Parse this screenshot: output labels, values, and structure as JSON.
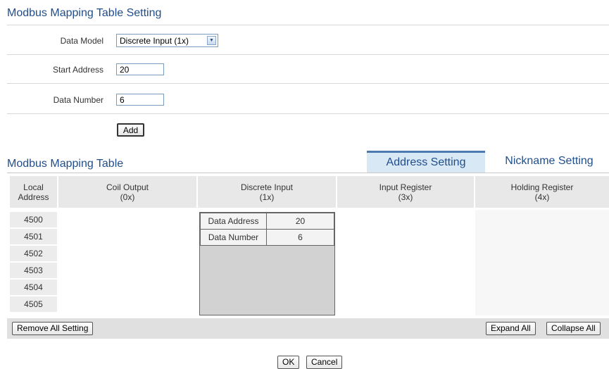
{
  "form": {
    "title": "Modbus Mapping Table Setting",
    "data_model_label": "Data Model",
    "data_model_value": "Discrete Input (1x)",
    "start_address_label": "Start Address",
    "start_address_value": "20",
    "data_number_label": "Data Number",
    "data_number_value": "6",
    "add_button": "Add"
  },
  "table": {
    "title": "Modbus Mapping Table",
    "tabs": {
      "address_setting": "Address Setting",
      "nickname_setting": "Nickname Setting"
    },
    "headers": {
      "local_address": [
        "Local",
        "Address"
      ],
      "coil_output": [
        "Coil Output",
        "(0x)"
      ],
      "discrete_input": [
        "Discrete Input",
        "(1x)"
      ],
      "input_register": [
        "Input Register",
        "(3x)"
      ],
      "holding_register": [
        "Holding Register",
        "(4x)"
      ]
    },
    "rows": [
      "4500",
      "4501",
      "4502",
      "4503",
      "4504",
      "4505"
    ],
    "discrete_entry": {
      "data_address_label": "Data Address",
      "data_address_value": "20",
      "data_number_label": "Data Number",
      "data_number_value": "6"
    },
    "remove_all_button": "Remove All Setting",
    "expand_all_button": "Expand All",
    "collapse_all_button": "Collapse All"
  },
  "footer": {
    "ok_button": "OK",
    "cancel_button": "Cancel"
  },
  "colors": {
    "title": "#1f4e8c",
    "active_tab": "#d9e8f5",
    "header_bg": "#e8e8e8",
    "block_bg": "#d2d2d2"
  }
}
